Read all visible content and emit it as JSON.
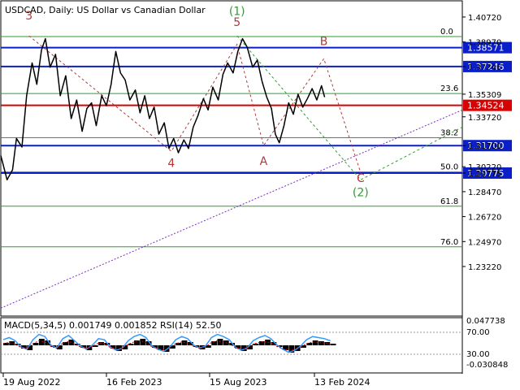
{
  "header": {
    "title": "USDCAD, Daily:  US Dollar vs Canadian Dollar",
    "indicator": "MACD(5,34,5) 0.001749 0.001852 RSI(14) 52.50"
  },
  "colors": {
    "price": "#000000",
    "fib": "#2e9e2e",
    "blue_level": "#0a1fc7",
    "red_level": "#d80000",
    "wave_red": "#b23a3a",
    "wave_green": "#2e9e2e",
    "trend": "#7b2fbf",
    "box_blue": "#0a1fc7",
    "box_red": "#d80000",
    "macd_hist": "#000000",
    "macd_red": "#cc0000",
    "rsi": "#3399ff"
  },
  "chart_data": {
    "type": "line",
    "title": "USDCAD, Daily:  US Dollar vs Canadian Dollar",
    "ylim": [
      1.198,
      1.418
    ],
    "y_ticks": [
      "1.40720",
      "1.38970",
      "1.37246",
      "1.35309",
      "1.33720",
      "1.31700",
      "1.30220",
      "1.29775",
      "1.28470",
      "1.26720",
      "1.24970",
      "1.23220"
    ],
    "x_ticks": [
      "19 Aug 2022",
      "16 Feb 2023",
      "15 Aug 2023",
      "13 Feb 2024"
    ],
    "price_points": [
      [
        0,
        1.31
      ],
      [
        0.8,
        1.293
      ],
      [
        1.5,
        1.3
      ],
      [
        2.0,
        1.322
      ],
      [
        2.7,
        1.316
      ],
      [
        3.3,
        1.352
      ],
      [
        4.0,
        1.375
      ],
      [
        4.6,
        1.36
      ],
      [
        5.2,
        1.384
      ],
      [
        5.7,
        1.392
      ],
      [
        6.3,
        1.372
      ],
      [
        7.0,
        1.381
      ],
      [
        7.6,
        1.352
      ],
      [
        8.3,
        1.366
      ],
      [
        9.0,
        1.336
      ],
      [
        9.7,
        1.349
      ],
      [
        10.4,
        1.327
      ],
      [
        11.0,
        1.343
      ],
      [
        11.6,
        1.347
      ],
      [
        12.2,
        1.331
      ],
      [
        12.9,
        1.352
      ],
      [
        13.5,
        1.345
      ],
      [
        14.1,
        1.36
      ],
      [
        14.7,
        1.383
      ],
      [
        15.3,
        1.368
      ],
      [
        15.9,
        1.363
      ],
      [
        16.5,
        1.349
      ],
      [
        17.2,
        1.356
      ],
      [
        17.8,
        1.34
      ],
      [
        18.4,
        1.352
      ],
      [
        19.0,
        1.336
      ],
      [
        19.6,
        1.344
      ],
      [
        20.2,
        1.325
      ],
      [
        20.9,
        1.333
      ],
      [
        21.5,
        1.315
      ],
      [
        22.1,
        1.322
      ],
      [
        22.7,
        1.312
      ],
      [
        23.4,
        1.321
      ],
      [
        24.0,
        1.315
      ],
      [
        24.6,
        1.33
      ],
      [
        25.2,
        1.338
      ],
      [
        25.9,
        1.35
      ],
      [
        26.5,
        1.342
      ],
      [
        27.1,
        1.358
      ],
      [
        27.8,
        1.349
      ],
      [
        28.4,
        1.367
      ],
      [
        29.0,
        1.375
      ],
      [
        29.7,
        1.368
      ],
      [
        30.3,
        1.383
      ],
      [
        30.9,
        1.392
      ],
      [
        31.5,
        1.386
      ],
      [
        32.2,
        1.372
      ],
      [
        32.8,
        1.377
      ],
      [
        33.4,
        1.362
      ],
      [
        34.0,
        1.351
      ],
      [
        34.6,
        1.343
      ],
      [
        35.1,
        1.325
      ],
      [
        35.6,
        1.319
      ],
      [
        36.2,
        1.331
      ],
      [
        36.8,
        1.347
      ],
      [
        37.4,
        1.339
      ],
      [
        38.0,
        1.353
      ],
      [
        38.6,
        1.344
      ],
      [
        39.2,
        1.35
      ],
      [
        39.8,
        1.357
      ],
      [
        40.4,
        1.349
      ],
      [
        41.0,
        1.359
      ],
      [
        41.4,
        1.351
      ]
    ],
    "horizontal_levels": [
      {
        "value": 1.38571,
        "label": "1.38571",
        "kind": "blue"
      },
      {
        "value": 1.37246,
        "label": "1.37246",
        "kind": "blue"
      },
      {
        "value": 1.34524,
        "label": "1.34524",
        "kind": "red"
      },
      {
        "value": 1.317,
        "label": "1.31700",
        "kind": "blue"
      },
      {
        "value": 1.29775,
        "label": "1.29775",
        "kind": "blue"
      }
    ],
    "fib_levels": [
      {
        "label": "0.0",
        "value": 1.3935
      },
      {
        "label": "23.6",
        "value": 1.3535
      },
      {
        "label": "38.2",
        "value": 1.3225
      },
      {
        "label": "50.0",
        "value": 1.2985
      },
      {
        "label": "61.8",
        "value": 1.2745
      },
      {
        "label": "76.0",
        "value": 1.246
      }
    ],
    "wave_labels": [
      {
        "text": "3",
        "t": 3.6,
        "v": 1.4055,
        "color": "red"
      },
      {
        "text": "(1)",
        "t": 30.2,
        "v": 1.4085,
        "color": "green"
      },
      {
        "text": "5",
        "t": 30.2,
        "v": 1.401,
        "color": "red"
      },
      {
        "text": "B",
        "t": 41.3,
        "v": 1.3875,
        "color": "red"
      },
      {
        "text": "4",
        "t": 21.8,
        "v": 1.302,
        "color": "red"
      },
      {
        "text": "A",
        "t": 33.6,
        "v": 1.3035,
        "color": "red"
      },
      {
        "text": "C",
        "t": 46.0,
        "v": 1.2915,
        "color": "red"
      },
      {
        "text": "(2)",
        "t": 46.0,
        "v": 1.2815,
        "color": "green"
      }
    ],
    "wave_path_red": [
      [
        3.6,
        1.394
      ],
      [
        21.8,
        1.313
      ],
      [
        30.2,
        1.388
      ],
      [
        33.6,
        1.317
      ],
      [
        41.3,
        1.378
      ],
      [
        46.0,
        1.298
      ]
    ],
    "wave_path_green": [
      [
        30.2,
        1.394
      ],
      [
        46.0,
        1.293
      ],
      [
        59.0,
        1.33
      ]
    ],
    "trendline": [
      [
        0,
        1.203
      ],
      [
        59.0,
        1.342
      ]
    ],
    "x_domain": [
      0,
      59
    ],
    "macd_rsi": {
      "ticks": [
        "0.047738",
        "70.00",
        "30.00",
        "-0.030848"
      ]
    }
  }
}
